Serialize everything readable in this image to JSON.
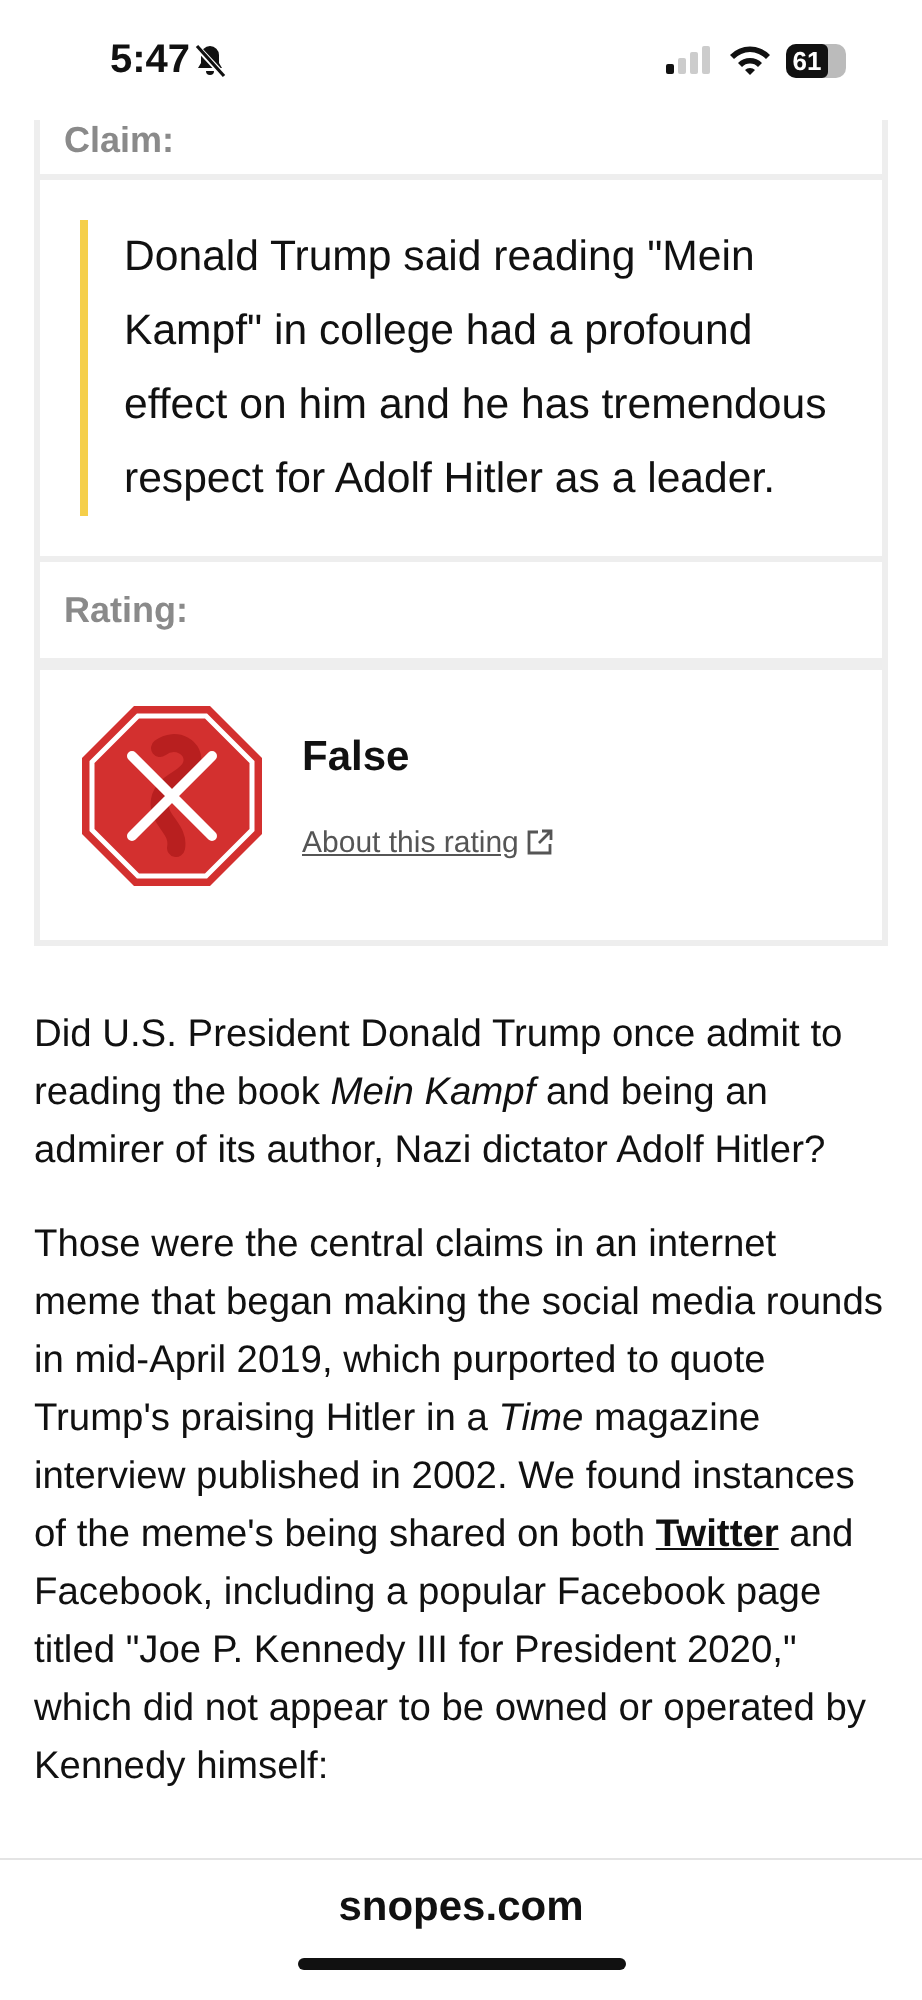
{
  "status_bar": {
    "time": "5:47",
    "muted": true,
    "battery": "61"
  },
  "claim": {
    "label": "Claim:",
    "text": "Donald Trump said reading \"Mein Kampf\" in college had a profound effect on him and he has tremendous respect for Adolf Hitler as a leader."
  },
  "rating": {
    "label": "Rating:",
    "verdict": "False",
    "kind": "false",
    "link": "About this rating"
  },
  "paragraphs": [
    [
      {
        "text": "Did U.S. President Donald Trump once admit to reading the book *Mein Kampf* and being an admirer of its author, Nazi dictator Adolf Hitler?"
      }
    ],
    [
      {
        "text": "Those were the central claims in an internet meme that began making the social media rounds in mid-April 2019, which purported to quote Trump's praising Hitler in a *Time* magazine interview published in 2002. We found instances of the meme's being shared on both "
      },
      {
        "link": "Twitter"
      },
      {
        "text": " and Facebook, including a popular Facebook page titled \"Joe P. Kennedy III for President 2020,\" which did not appear to be owned or operated by Kennedy himself:"
      }
    ]
  ],
  "address_bar": {
    "domain": "snopes.com"
  }
}
